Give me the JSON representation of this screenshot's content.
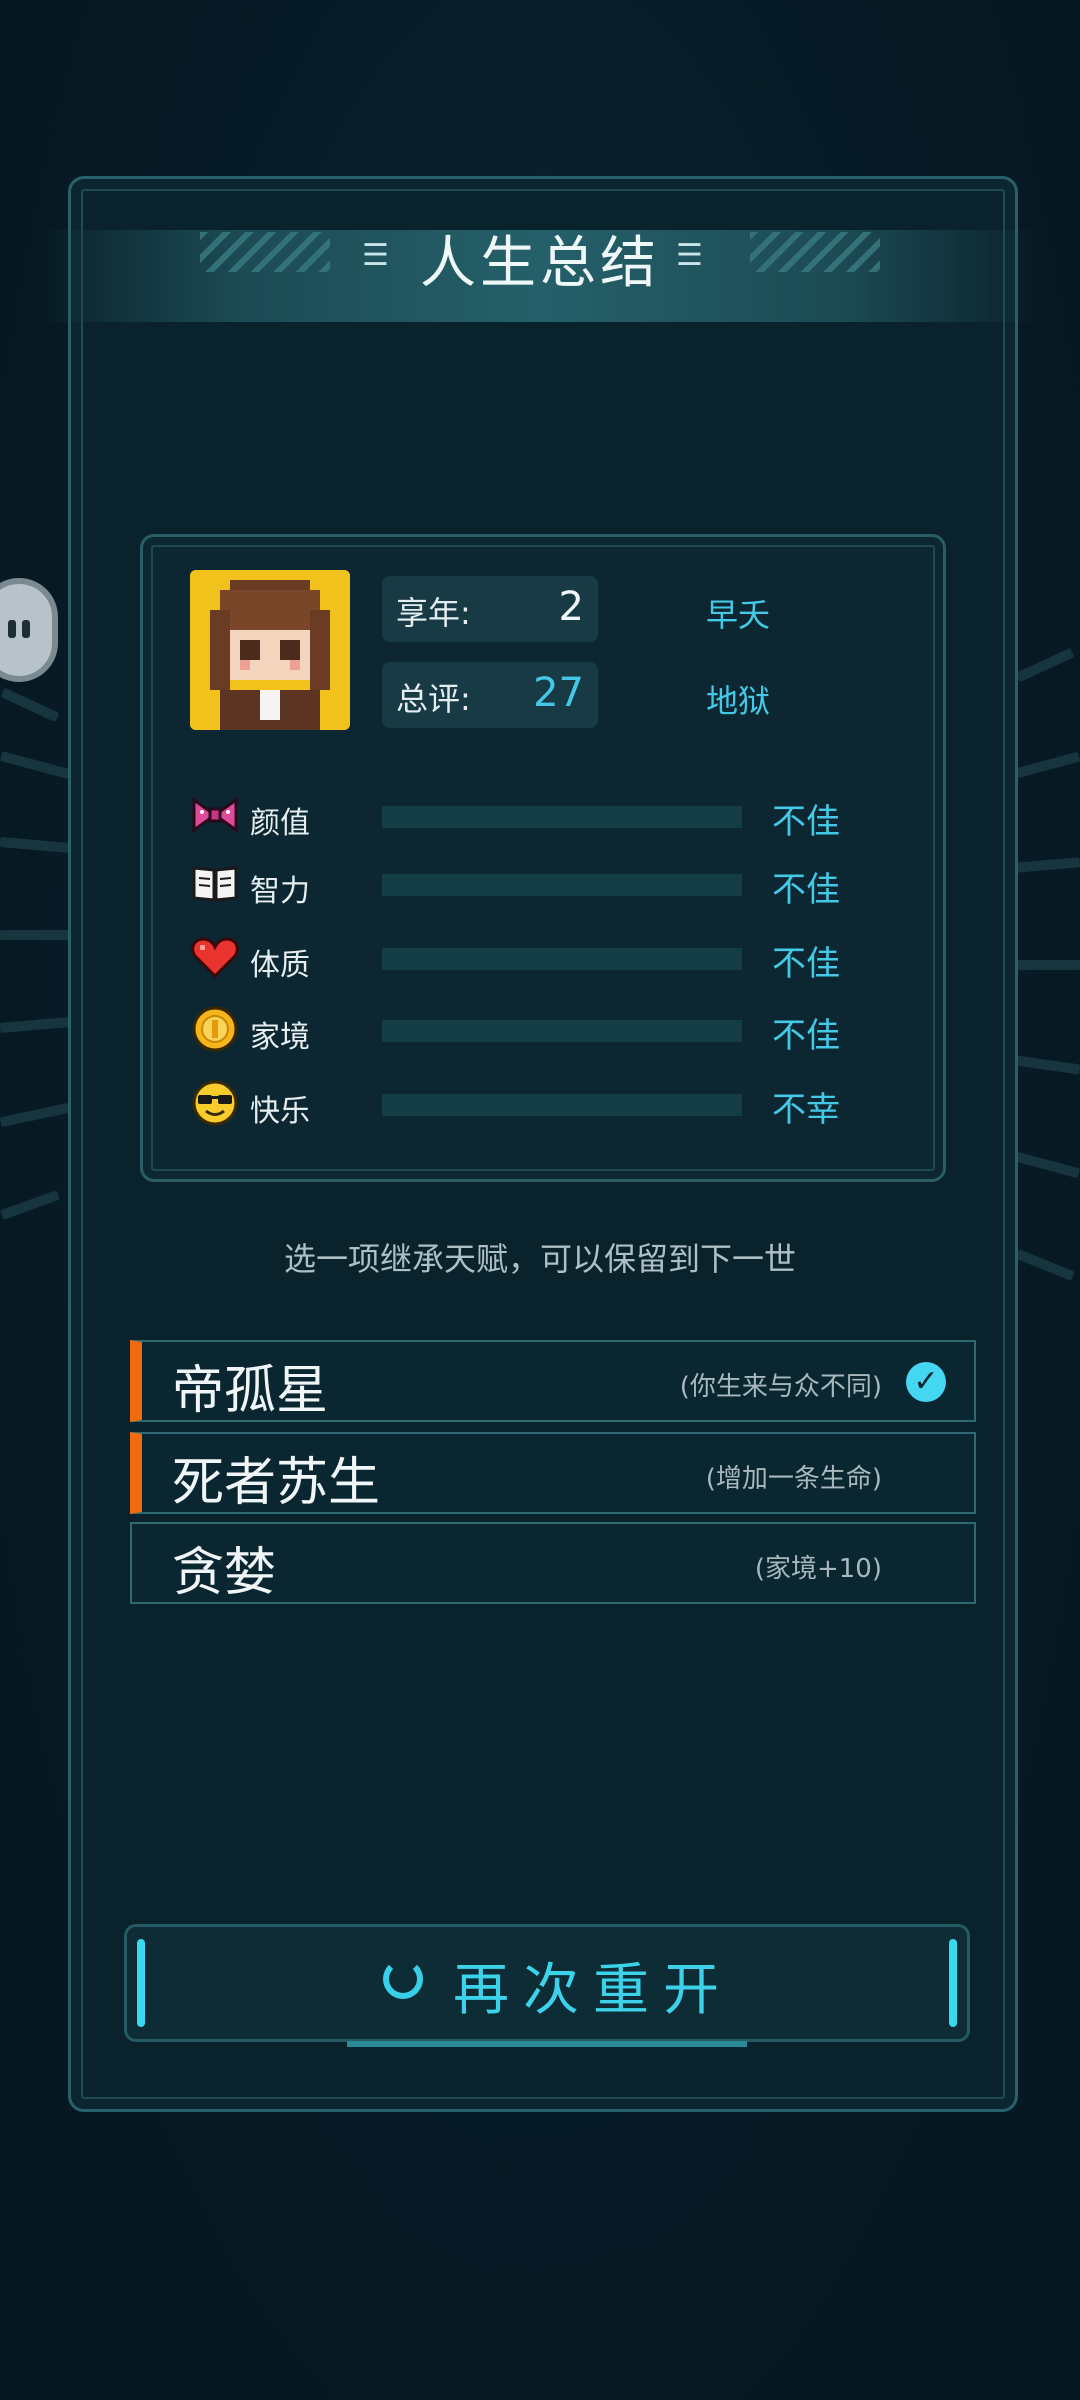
{
  "header": {
    "title": "人生总结"
  },
  "summary": {
    "age_label": "享年:",
    "age_value": "2",
    "age_desc": "早夭",
    "score_label": "总评:",
    "score_value": "27",
    "score_desc": "地狱"
  },
  "attributes": [
    {
      "icon": "bow-icon",
      "label": "颜值",
      "value": "不佳",
      "fill": 0
    },
    {
      "icon": "book-icon",
      "label": "智力",
      "value": "不佳",
      "fill": 0
    },
    {
      "icon": "heart-icon",
      "label": "体质",
      "value": "不佳",
      "fill": 0
    },
    {
      "icon": "coin-icon",
      "label": "家境",
      "value": "不佳",
      "fill": 0
    },
    {
      "icon": "sunglasses-face-icon",
      "label": "快乐",
      "value": "不幸",
      "fill": 0
    }
  ],
  "hint": "选一项继承天赋，可以保留到下一世",
  "talents": [
    {
      "name": "帝孤星",
      "desc": "(你生来与众不同)",
      "selected": true,
      "checked": true
    },
    {
      "name": "死者苏生",
      "desc": "(增加一条生命)",
      "selected": true,
      "checked": false
    },
    {
      "name": "贪婪",
      "desc": "(家境+10)",
      "selected": false,
      "checked": false
    }
  ],
  "restart_label": "再次重开",
  "colors": {
    "accent": "#43c9e6",
    "selection": "#f06a10",
    "background": "#071b26"
  }
}
